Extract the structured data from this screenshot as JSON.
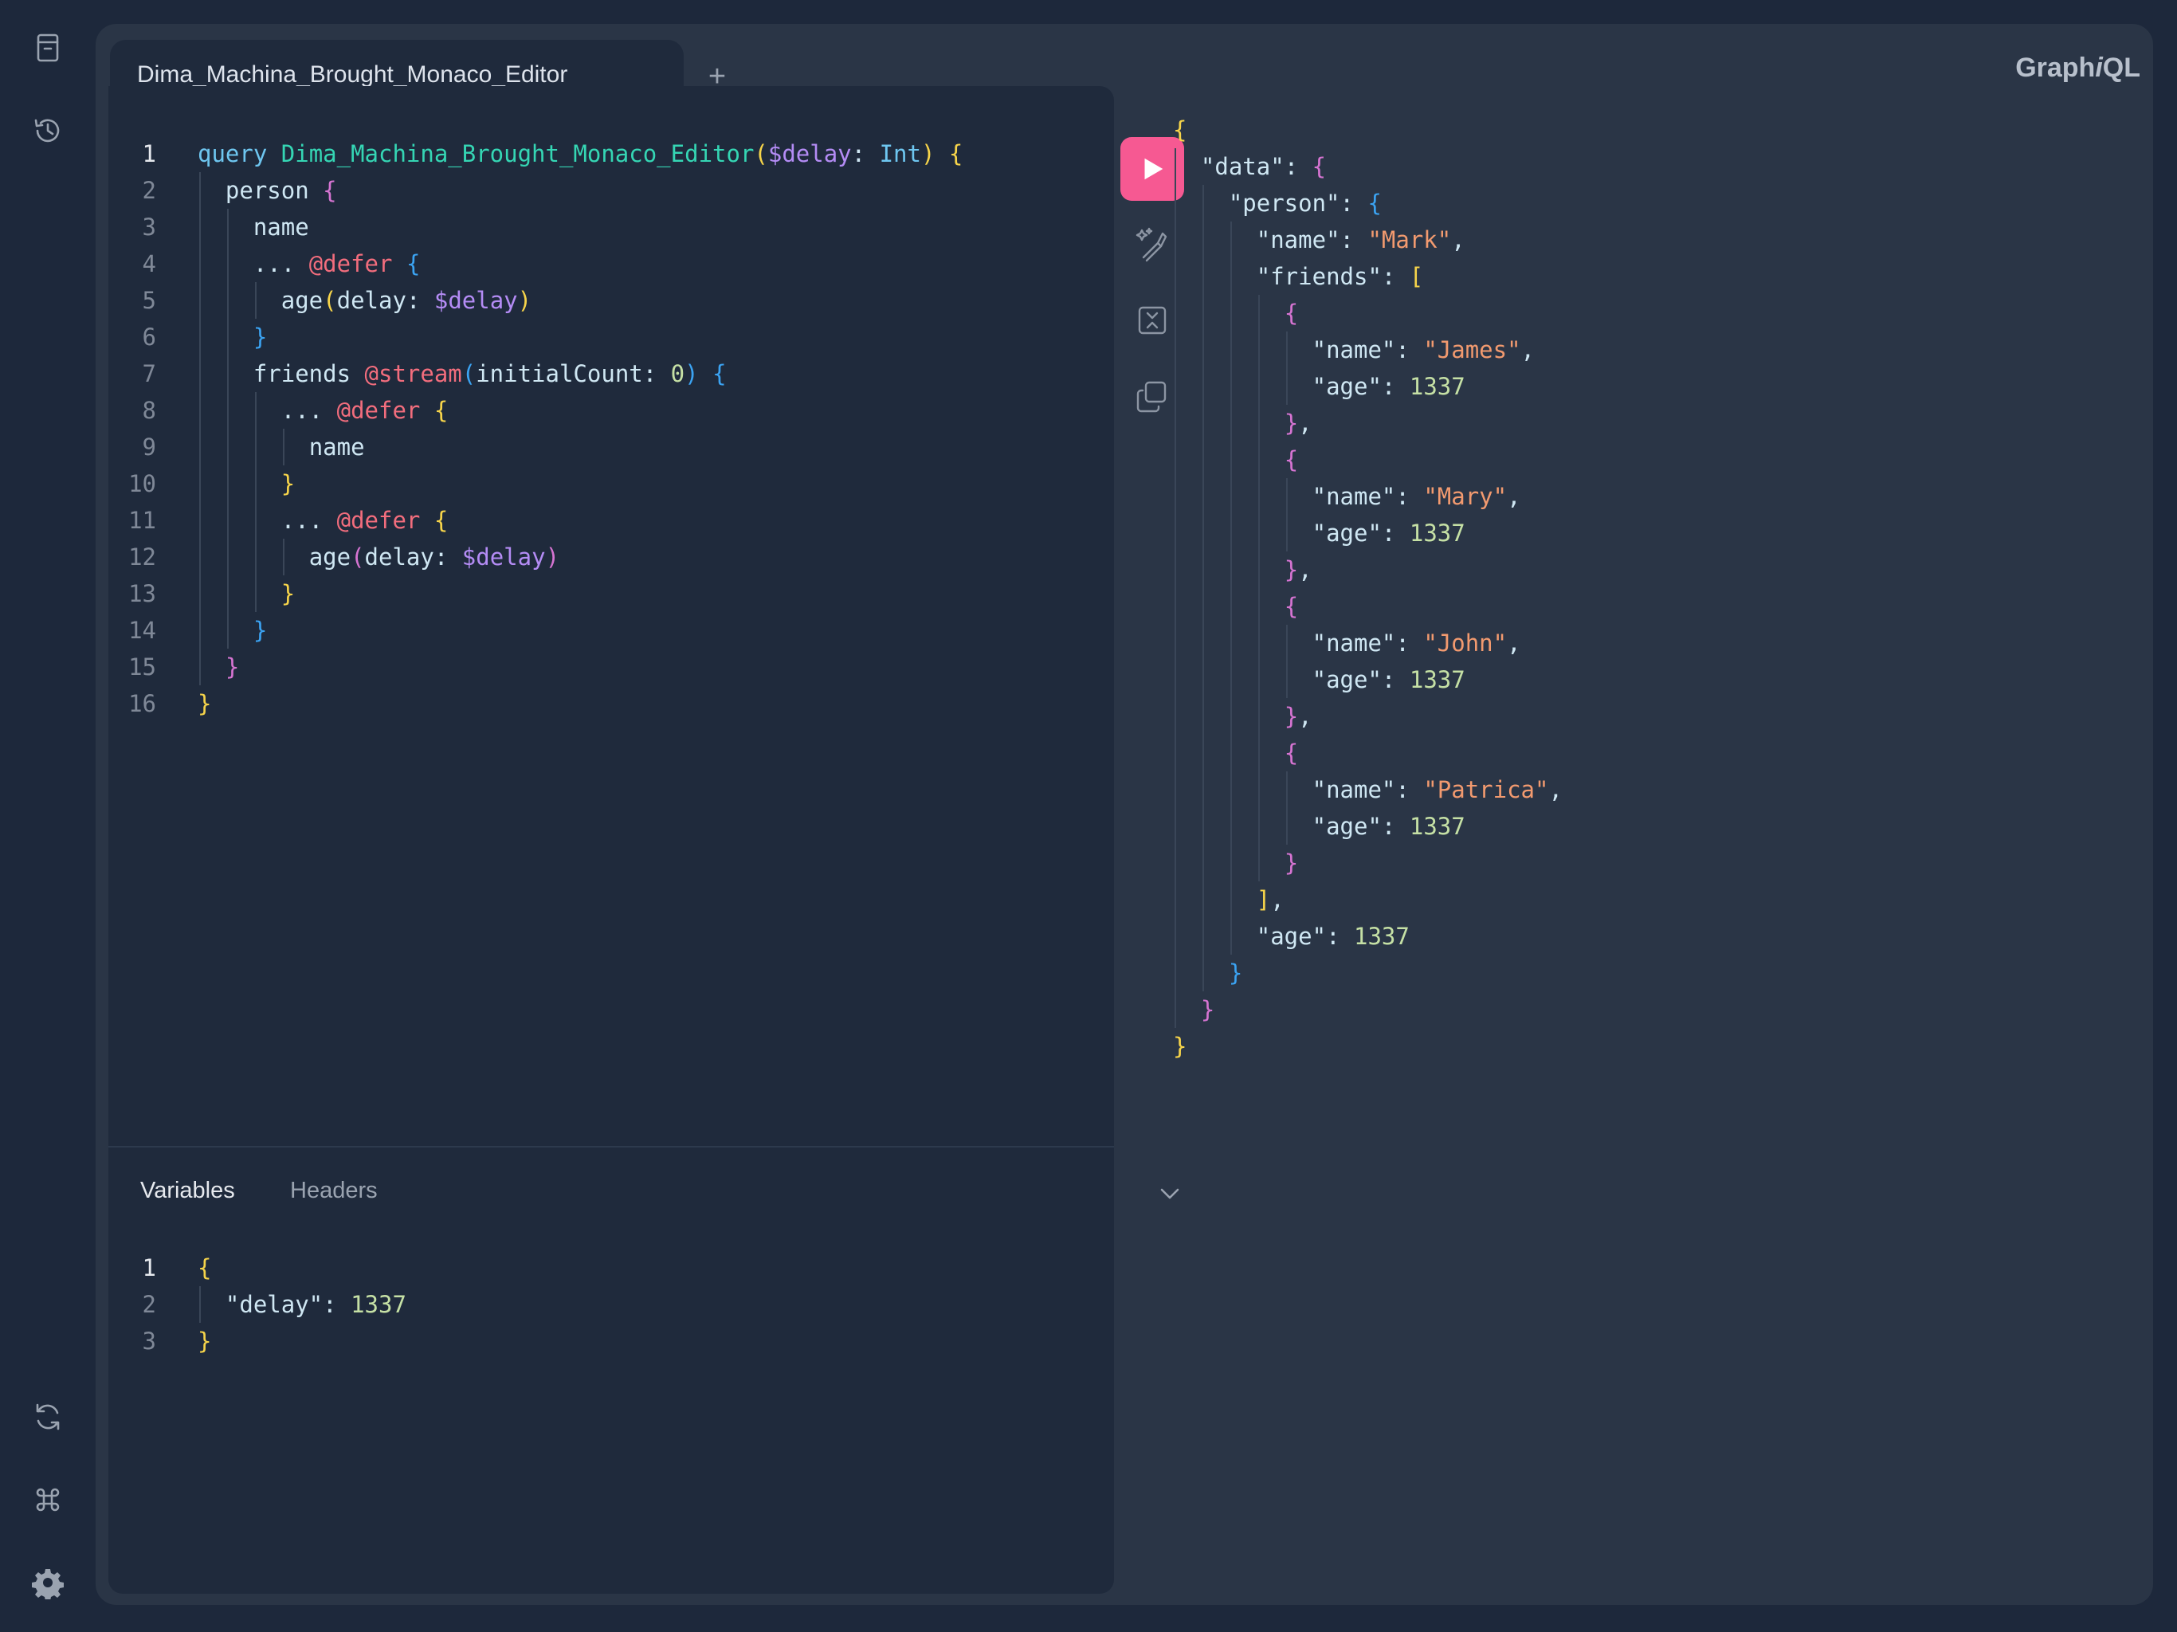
{
  "sidebar": {
    "top_icons": [
      "docs-icon",
      "history-icon"
    ],
    "bottom_icons": [
      "refresh-icon",
      "shortcuts-icon",
      "settings-icon"
    ]
  },
  "tabs": [
    {
      "label": "Dima_Machina_Brought_Monaco_Editor",
      "active": true
    }
  ],
  "tab_add_label": "+",
  "logo": {
    "prefix": "Graph",
    "italic": "i",
    "suffix": "QL"
  },
  "query_lines": [
    "query Dima_Machina_Brought_Monaco_Editor($delay: Int) {",
    "  person {",
    "    name",
    "    ... @defer {",
    "      age(delay: $delay)",
    "    }",
    "    friends @stream(initialCount: 0) {",
    "      ... @defer {",
    "        name",
    "      }",
    "      ... @defer {",
    "        age(delay: $delay)",
    "      }",
    "    }",
    "  }",
    "}"
  ],
  "variables_tabs": {
    "variables": "Variables",
    "headers": "Headers"
  },
  "variables_lines": [
    "{",
    "  \"delay\": 1337",
    "}"
  ],
  "response_lines": [
    "{",
    "  \"data\": {",
    "    \"person\": {",
    "      \"name\": \"Mark\",",
    "      \"friends\": [",
    "        {",
    "          \"name\": \"James\",",
    "          \"age\": 1337",
    "        },",
    "        {",
    "          \"name\": \"Mary\",",
    "          \"age\": 1337",
    "        },",
    "        {",
    "          \"name\": \"John\",",
    "          \"age\": 1337",
    "        },",
    "        {",
    "          \"name\": \"Patrica\",",
    "          \"age\": 1337",
    "        }",
    "      ],",
    "      \"age\": 1337",
    "    }",
    "  }",
    "}"
  ],
  "colors": {
    "background": "#1d283b",
    "shell": "#2a3546",
    "editor": "#1f2a3c",
    "run_button": "#f65992"
  }
}
